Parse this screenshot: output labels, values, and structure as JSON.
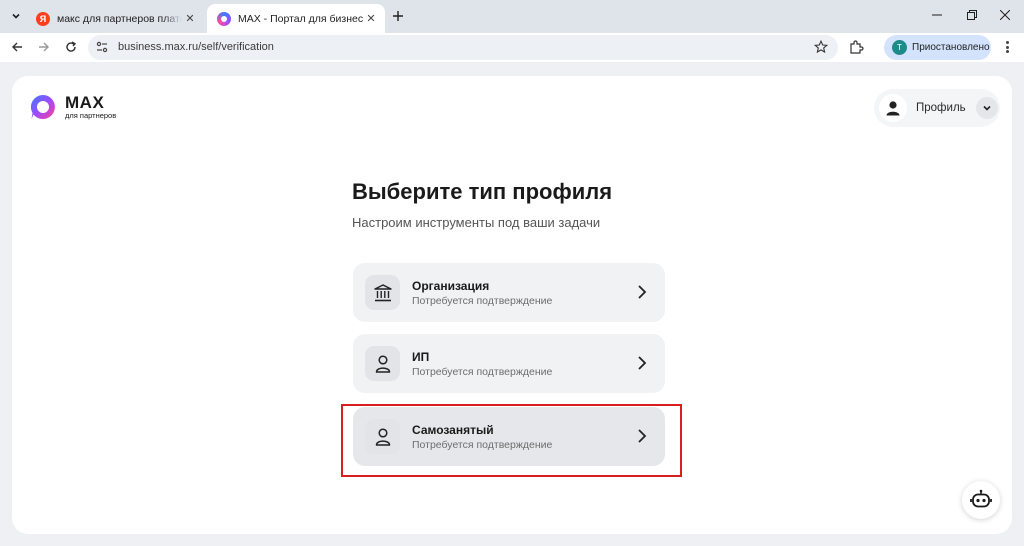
{
  "browser": {
    "tabs": [
      {
        "title": "макс для партнеров платформ",
        "favicon": "yandex-icon",
        "favicon_letter": "Я",
        "active": false
      },
      {
        "title": "MAX - Портал для бизнеса",
        "favicon": "max-icon",
        "active": true
      }
    ],
    "url": "business.max.ru/self/verification",
    "profile": {
      "initial": "Т",
      "label": "Приостановлено"
    }
  },
  "app": {
    "logo": {
      "name": "MAX",
      "subtitle": "для партнеров"
    },
    "profile_button": {
      "label": "Профиль"
    }
  },
  "main": {
    "title": "Выберите тип профиля",
    "subtitle": "Настроим инструменты под ваши задачи",
    "options": [
      {
        "name": "Организация",
        "description": "Потребуется подтверждение",
        "icon": "bank-icon"
      },
      {
        "name": "ИП",
        "description": "Потребуется подтверждение",
        "icon": "person-icon"
      },
      {
        "name": "Самозанятый",
        "description": "Потребуется подтверждение",
        "icon": "person-icon"
      }
    ]
  },
  "colors": {
    "highlight": "#d81e1e",
    "accent": "#d3e3fd"
  }
}
